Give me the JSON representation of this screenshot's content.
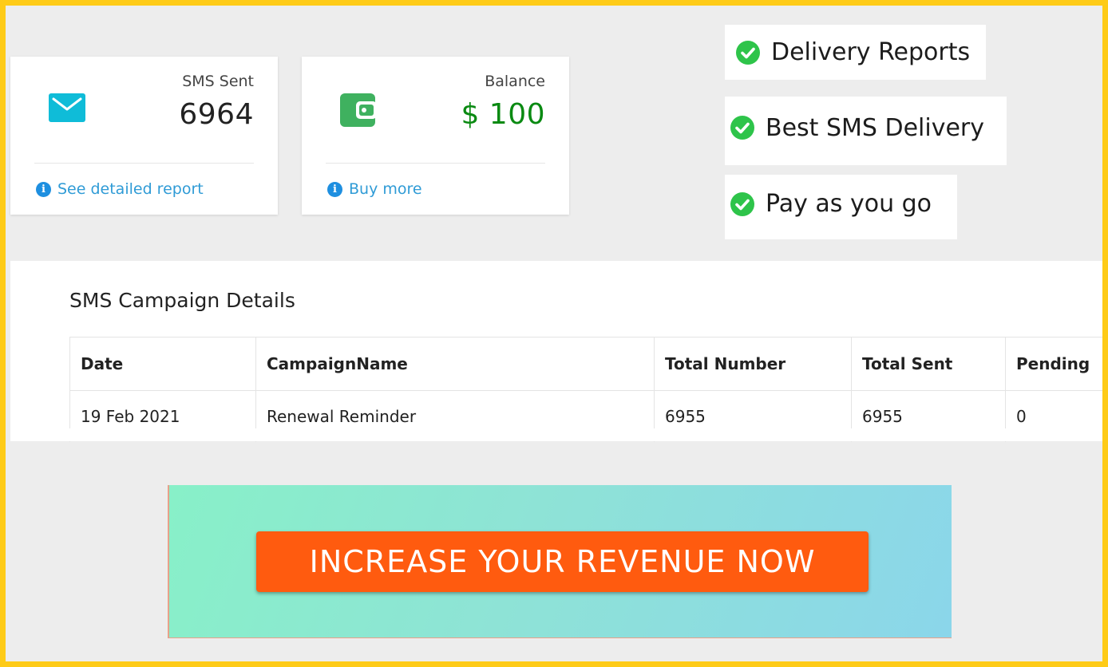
{
  "stats": {
    "sms_sent": {
      "label": "SMS Sent",
      "value": "6964",
      "link": "See detailed report",
      "icon": "envelope-icon",
      "icon_color": "#0fbcd8",
      "value_color": "#222222"
    },
    "balance": {
      "label": "Balance",
      "value": "$ 100",
      "link": "Buy more",
      "icon": "wallet-icon",
      "icon_color": "#3fb15f",
      "value_color": "#0a8a12"
    }
  },
  "features": [
    {
      "label": "Delivery Reports",
      "icon": "check-circle-icon"
    },
    {
      "label": "Best SMS Delivery",
      "icon": "check-circle-icon"
    },
    {
      "label": "Pay as you go",
      "icon": "check-circle-icon"
    }
  ],
  "campaigns": {
    "title": "SMS Campaign Details",
    "columns": [
      "Date",
      "CampaignName",
      "Total Number",
      "Total Sent",
      "Pending"
    ],
    "rows": [
      {
        "date": "19 Feb 2021",
        "name": "Renewal Reminder",
        "total_number": "6955",
        "total_sent": "6955",
        "pending": "0"
      }
    ]
  },
  "promo": {
    "cta_label": "INCREASE YOUR REVENUE NOW",
    "cta_color": "#ff5b0f"
  },
  "colors": {
    "frame_border": "#fecb18",
    "check_green": "#2ec44a",
    "link_blue": "#2f9bd6"
  }
}
